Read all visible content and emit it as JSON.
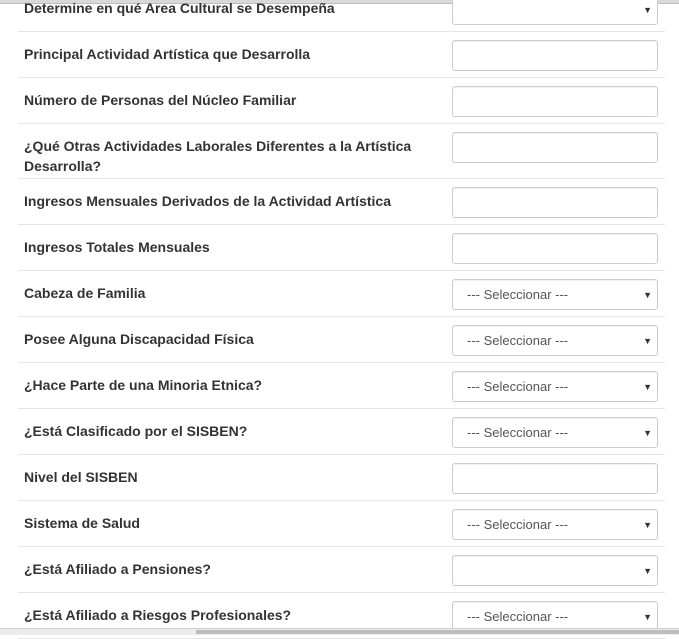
{
  "form": {
    "rows": [
      {
        "label": "Determine en qué Area Cultural se Desempeña",
        "type": "select",
        "value": ""
      },
      {
        "label": "Principal Actividad Artística que Desarrolla",
        "type": "input",
        "value": ""
      },
      {
        "label": "Número de Personas del Núcleo Familiar",
        "type": "input",
        "value": ""
      },
      {
        "label": "¿Qué Otras Actividades Laborales Diferentes a la Artística Desarrolla?",
        "type": "input",
        "value": ""
      },
      {
        "label": "Ingresos Mensuales Derivados de la Actividad Artística",
        "type": "input",
        "value": ""
      },
      {
        "label": "Ingresos Totales Mensuales",
        "type": "input",
        "value": ""
      },
      {
        "label": "Cabeza de Familia",
        "type": "select",
        "value": "--- Seleccionar ---"
      },
      {
        "label": "Posee Alguna Discapacidad Física",
        "type": "select",
        "value": "--- Seleccionar ---"
      },
      {
        "label": "¿Hace Parte de una Minoria Etnica?",
        "type": "select",
        "value": "--- Seleccionar ---"
      },
      {
        "label": "¿Está Clasificado por el SISBEN?",
        "type": "select",
        "value": "--- Seleccionar ---"
      },
      {
        "label": "Nivel del SISBEN",
        "type": "input",
        "value": ""
      },
      {
        "label": "Sistema de Salud",
        "type": "select",
        "value": "--- Seleccionar ---"
      },
      {
        "label": "¿Está Afiliado a Pensiones?",
        "type": "select",
        "value": ""
      },
      {
        "label": "¿Está Afiliado a Riesgos Profesionales?",
        "type": "select",
        "value": "--- Seleccionar ---"
      }
    ]
  },
  "icons": {
    "caret": "caret-down-icon"
  }
}
